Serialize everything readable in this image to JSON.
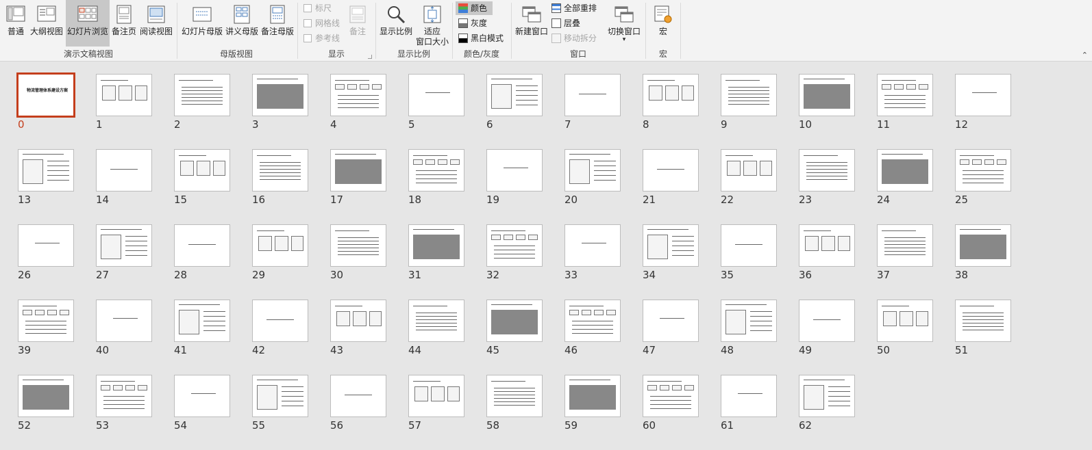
{
  "ribbon": {
    "presentation_views": {
      "label": "演示文稿视图",
      "buttons": [
        {
          "name": "normal-view",
          "label": "普通"
        },
        {
          "name": "outline-view",
          "label": "大纲视图"
        },
        {
          "name": "slide-sorter",
          "label": "幻灯片浏览"
        },
        {
          "name": "notes-page",
          "label": "备注页"
        },
        {
          "name": "reading-view",
          "label": "阅读视图"
        }
      ]
    },
    "master_views": {
      "label": "母版视图",
      "buttons": [
        {
          "name": "slide-master",
          "label": "幻灯片母版"
        },
        {
          "name": "handout-master",
          "label": "讲义母版"
        },
        {
          "name": "notes-master",
          "label": "备注母版"
        }
      ]
    },
    "show": {
      "label": "显示",
      "ruler": "标尺",
      "gridlines": "网格线",
      "guides": "参考线",
      "notes": "备注"
    },
    "zoom": {
      "label": "显示比例",
      "zoom_button": "显示比例",
      "fit_line1": "适应",
      "fit_line2": "窗口大小"
    },
    "color": {
      "label": "颜色/灰度",
      "color": "颜色",
      "grayscale": "灰度",
      "bw": "黑白模式"
    },
    "window": {
      "label": "窗口",
      "new_window": "新建窗口",
      "arrange_all": "全部重排",
      "cascade": "层叠",
      "move_split": "移动拆分",
      "switch_windows": "切换窗口",
      "switch_arrow": "▾"
    },
    "macros": {
      "label": "宏",
      "button": "宏"
    },
    "collapse": "⌃"
  },
  "slides": {
    "selected": "0",
    "s0": {
      "num": "0",
      "title": "物流管理体系建设方案"
    },
    "numbers": [
      "0",
      "1",
      "2",
      "3",
      "4",
      "5",
      "6",
      "7",
      "8",
      "9",
      "10",
      "11",
      "12",
      "13",
      "14",
      "15",
      "16",
      "17",
      "18",
      "19",
      "20",
      "21",
      "22",
      "23",
      "24",
      "25",
      "26",
      "27",
      "28",
      "29",
      "30",
      "31",
      "32",
      "33",
      "34",
      "35",
      "36",
      "37",
      "38",
      "39",
      "40",
      "41",
      "42",
      "43",
      "44",
      "45",
      "46",
      "47",
      "48",
      "49",
      "50",
      "51",
      "52",
      "53",
      "54",
      "55",
      "56",
      "57",
      "58",
      "59",
      "60",
      "61",
      "62"
    ]
  },
  "colors": {
    "selection": "#c43e1c",
    "active_button": "#c8c8c8"
  }
}
